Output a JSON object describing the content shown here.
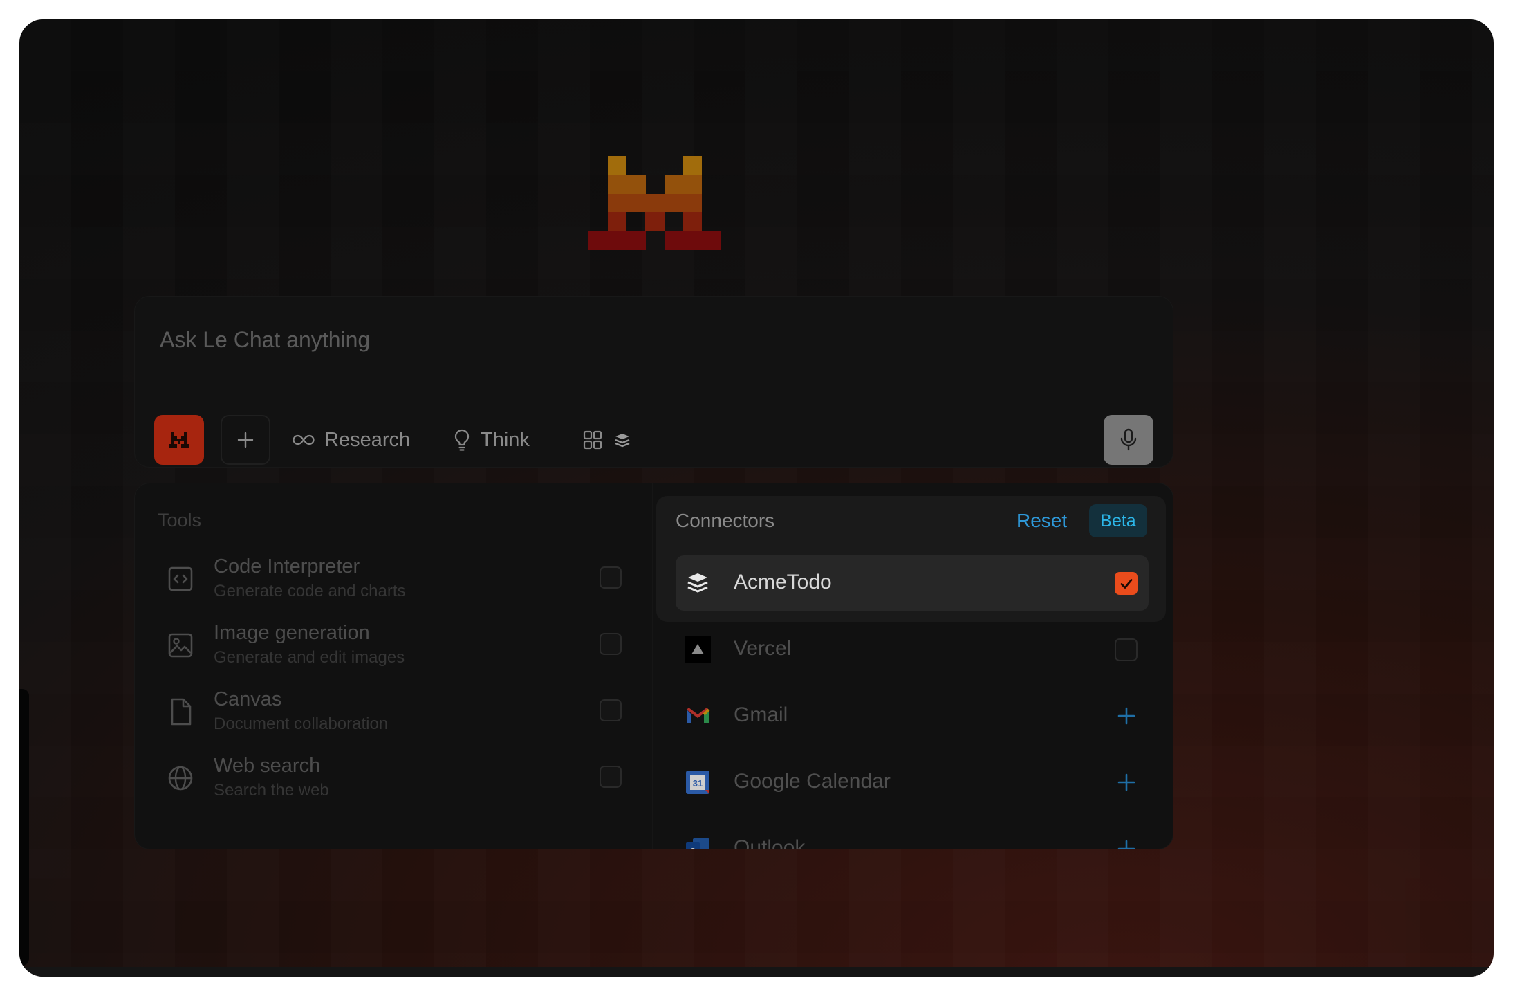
{
  "composer": {
    "placeholder": "Ask Le Chat anything",
    "research_label": "Research",
    "think_label": "Think"
  },
  "tools": {
    "header": "Tools",
    "items": [
      {
        "title": "Code Interpreter",
        "subtitle": "Generate code and charts",
        "icon": "code-icon",
        "checked": false
      },
      {
        "title": "Image generation",
        "subtitle": "Generate and edit images",
        "icon": "image-icon",
        "checked": false
      },
      {
        "title": "Canvas",
        "subtitle": "Document collaboration",
        "icon": "document-icon",
        "checked": false
      },
      {
        "title": "Web search",
        "subtitle": "Search the web",
        "icon": "globe-icon",
        "checked": false
      }
    ]
  },
  "connectors": {
    "header": "Connectors",
    "reset_label": "Reset",
    "badge": "Beta",
    "items": [
      {
        "label": "AcmeTodo",
        "icon": "acmetodo-icon",
        "state": "checked"
      },
      {
        "label": "Vercel",
        "icon": "vercel-icon",
        "state": "unchecked"
      },
      {
        "label": "Gmail",
        "icon": "gmail-icon",
        "state": "add"
      },
      {
        "label": "Google Calendar",
        "icon": "google-calendar-icon",
        "state": "add"
      },
      {
        "label": "Outlook",
        "icon": "outlook-icon",
        "state": "add"
      }
    ]
  },
  "colors": {
    "accent": "#ea4c1c",
    "link": "#2e98d8",
    "model_button": "#a7250f"
  }
}
